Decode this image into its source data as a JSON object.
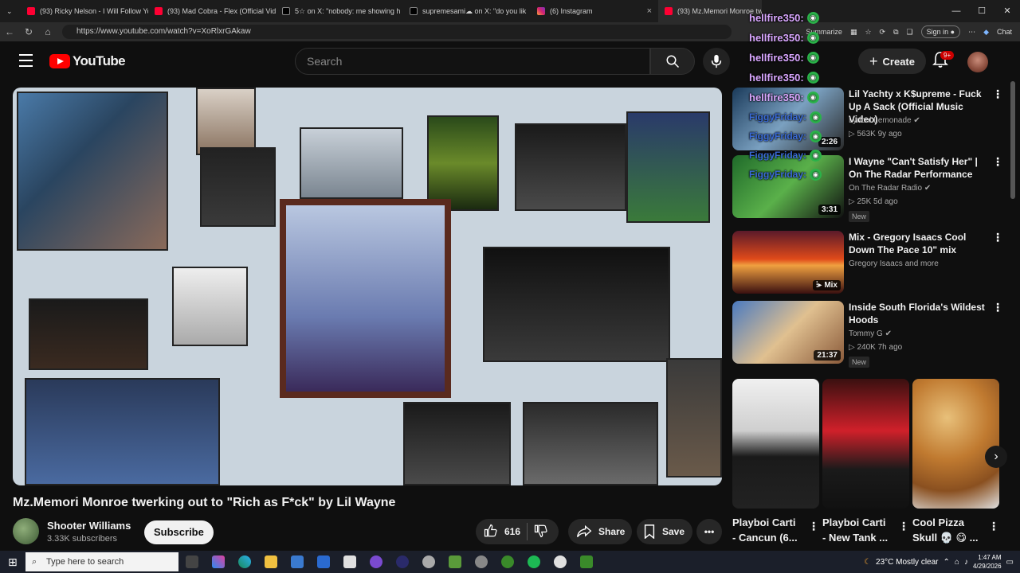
{
  "browser": {
    "tabs": [
      {
        "title": "(93) Ricky Nelson - I Will Follow Yo",
        "icon": "youtube-icon"
      },
      {
        "title": "(93) Mad Cobra - Flex (Official Vid",
        "icon": "youtube-icon"
      },
      {
        "title": "5☆ on X: \"nobody: me showing h",
        "icon": "x-icon"
      },
      {
        "title": "supremesami☁ on X: \"do you lik",
        "icon": "x-icon"
      },
      {
        "title": "(6) Instagram",
        "icon": "instagram-icon"
      },
      {
        "title": "(93) Mz.Memori Monroe tw",
        "icon": "youtube-icon",
        "active": true
      }
    ],
    "url": "https://www.youtube.com/watch?v=XoRlxrGAkaw",
    "summarize": "Summarize",
    "signin": "Sign in",
    "chat": "Chat"
  },
  "yt": {
    "logo": "YouTube",
    "search_placeholder": "Search",
    "create": "Create",
    "notif_count": "9+"
  },
  "video": {
    "title": "Mz.Memori Monroe twerking out to \"Rich as F*ck\" by Lil Wayne",
    "channel": "Shooter Williams",
    "subs": "3.33K subscribers",
    "subscribe": "Subscribe",
    "likes": "616",
    "share": "Share",
    "save": "Save"
  },
  "recs": [
    {
      "title": "Lil Yachty x K$upreme - Fuck Up A Sack (Official Music Video)",
      "channel": "Lyrical Lemonade",
      "verified": true,
      "meta": "▷ 563K  9y ago",
      "duration": "2:26"
    },
    {
      "title": "I Wayne \"Can't Satisfy Her\" | On The Radar Performance",
      "channel": "On The Radar Radio",
      "verified": true,
      "meta": "▷ 25K  5d ago",
      "duration": "3:31",
      "badge": "New"
    },
    {
      "title": "Mix - Gregory Isaacs Cool Down The Pace 10\" mix",
      "channel": "Gregory Isaacs and more",
      "duration": "Mix"
    },
    {
      "title": "Inside South Florida's Wildest Hoods",
      "channel": "Tommy G",
      "verified": true,
      "meta": "▷ 240K  7h ago",
      "duration": "21:37",
      "badge": "New"
    }
  ],
  "shorts": [
    {
      "title": "Playboi Carti - Cancun (6..."
    },
    {
      "title": "Playboi Carti - New Tank ..."
    },
    {
      "title": "Cool Pizza Skull 💀 😋 ..."
    }
  ],
  "overlay_chat": [
    {
      "user": "hellfire350:",
      "kind": "hell"
    },
    {
      "user": "hellfire350:",
      "kind": "hell"
    },
    {
      "user": "hellfire350:",
      "kind": "hell"
    },
    {
      "user": "hellfire350:",
      "kind": "hell"
    },
    {
      "user": "hellfire350:",
      "kind": "hell"
    },
    {
      "user": "FiggyFriday:",
      "kind": "fig"
    },
    {
      "user": "FiggyFriday:",
      "kind": "fig"
    },
    {
      "user": "FiggyFriday:",
      "kind": "fig"
    },
    {
      "user": "FiggyFriday:",
      "kind": "fig"
    }
  ],
  "taskbar": {
    "search": "Type here to search",
    "weather": "23°C  Mostly clear",
    "time": "1:47 AM",
    "date": "4/29/2026"
  }
}
